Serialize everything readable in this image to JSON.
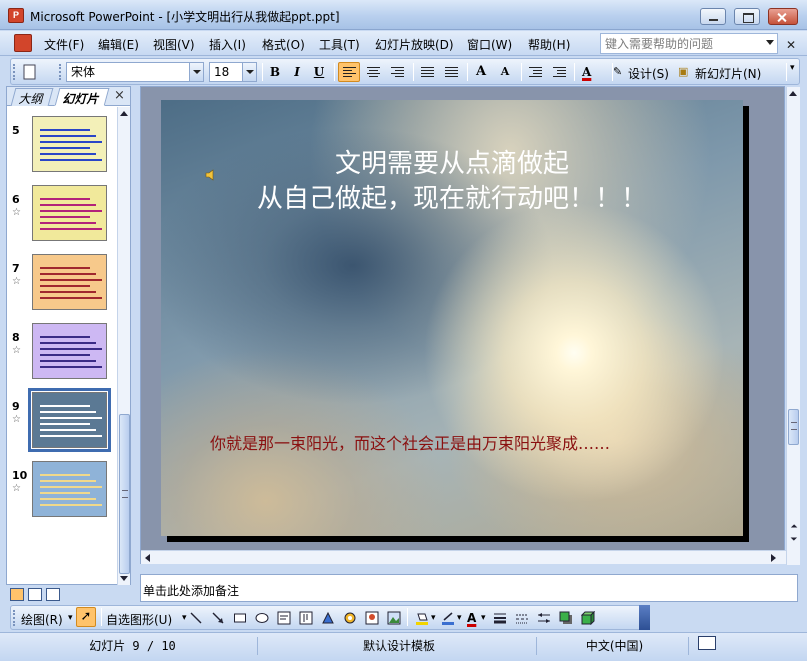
{
  "window": {
    "title": "Microsoft PowerPoint - [小学文明出行从我做起ppt.ppt]",
    "app_icon": "P"
  },
  "menu": {
    "items": [
      "文件(F)",
      "编辑(E)",
      "视图(V)",
      "插入(I)",
      "格式(O)",
      "工具(T)",
      "幻灯片放映(D)",
      "窗口(W)",
      "帮助(H)"
    ],
    "help_placeholder": "键入需要帮助的问题"
  },
  "toolbar": {
    "font_name": "宋体",
    "font_size": "18",
    "bold": "B",
    "italic": "I",
    "underline": "U",
    "grow_font": "A",
    "shrink_font": "A",
    "font_color": "A",
    "design_label": "设计(S)",
    "new_slide_label": "新幻灯片(N)"
  },
  "left_panel": {
    "tab_outline": "大纲",
    "tab_slides": "幻灯片",
    "close": "×",
    "slides": [
      {
        "number": "5",
        "star": "",
        "bg": "#f3f0b8",
        "line": "#2a46c7"
      },
      {
        "number": "6",
        "star": "☆",
        "bg": "#f1e99b",
        "line": "#b2227a"
      },
      {
        "number": "7",
        "star": "☆",
        "bg": "#f7c98b",
        "line": "#a0282e"
      },
      {
        "number": "8",
        "star": "☆",
        "bg": "#cdb8f3",
        "line": "#3b2b86"
      },
      {
        "number": "9",
        "star": "☆",
        "bg": "#5b7994",
        "line": "#ffffff",
        "selected": true
      },
      {
        "number": "10",
        "star": "☆",
        "bg": "#8fb3d8",
        "line": "#f1d98a"
      }
    ]
  },
  "slide": {
    "title_line1": "文明需要从点滴做起",
    "title_line2": "从自己做起，现在就行动吧！！！",
    "body": "你就是那一束阳光，而这个社会正是由万束阳光聚成……",
    "title_color": "#ffffff",
    "body_color": "#8a1010"
  },
  "notes": {
    "placeholder": "单击此处添加备注"
  },
  "drawing_toolbar": {
    "draw_label": "绘图(R)",
    "autoshapes_label": "自选图形(U)"
  },
  "status": {
    "slide_indicator": "幻灯片 9 / 10",
    "template": "默认设计模板",
    "language": "中文(中国)"
  },
  "colors": {
    "accent": "#ffc36b",
    "chrome": "#c4d7f1"
  }
}
